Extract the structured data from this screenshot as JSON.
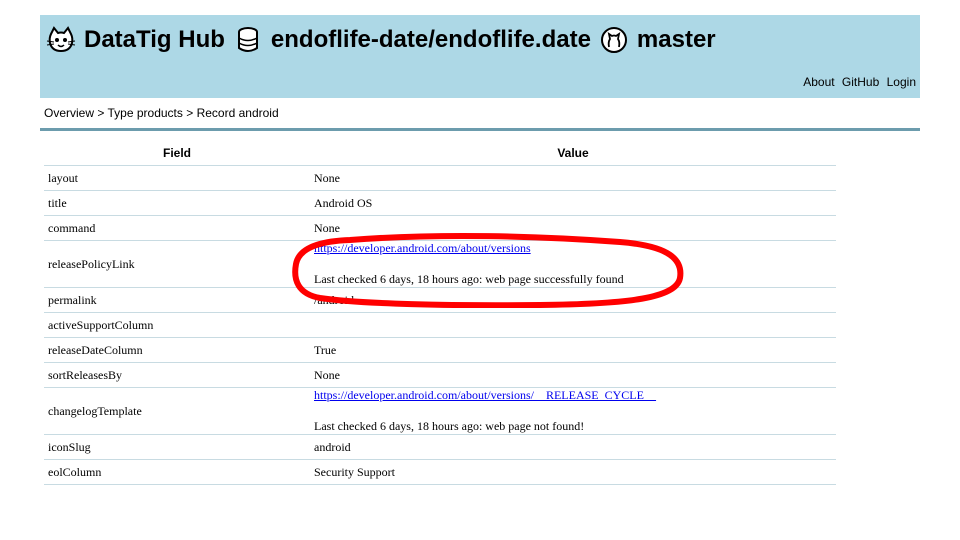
{
  "header": {
    "site_name": "DataTig Hub",
    "repository": "endoflife-date/endoflife.date",
    "branch": "master",
    "nav": [
      "About",
      "GitHub",
      "Login"
    ]
  },
  "breadcrumb": [
    "Overview",
    ">",
    "Type products",
    ">",
    "Record android"
  ],
  "table": {
    "columns": [
      "Field",
      "Value"
    ],
    "rows": [
      {
        "field": "layout",
        "value": "None"
      },
      {
        "field": "title",
        "value": "Android OS"
      },
      {
        "field": "command",
        "value": "None"
      },
      {
        "field": "releasePolicyLink",
        "link": "https://developer.android.com/about/versions",
        "note": "Last checked 6 days, 18 hours ago: web page successfully found"
      },
      {
        "field": "permalink",
        "value": "/android"
      },
      {
        "field": "activeSupportColumn",
        "value": ""
      },
      {
        "field": "releaseDateColumn",
        "value": "True"
      },
      {
        "field": "sortReleasesBy",
        "value": "None"
      },
      {
        "field": "changelogTemplate",
        "link": "https://developer.android.com/about/versions/__RELEASE_CYCLE__",
        "note": "Last checked 6 days, 18 hours ago: web page not found!"
      },
      {
        "field": "iconSlug",
        "value": "android"
      },
      {
        "field": "eolColumn",
        "value": "Security Support"
      }
    ]
  },
  "colors": {
    "header_bg": "#add8e6",
    "rule": "#6c9cad",
    "annotation": "#ff0000",
    "link": "#0000ee"
  },
  "icons": [
    "cat-logo-icon",
    "database-icon",
    "github-icon"
  ]
}
